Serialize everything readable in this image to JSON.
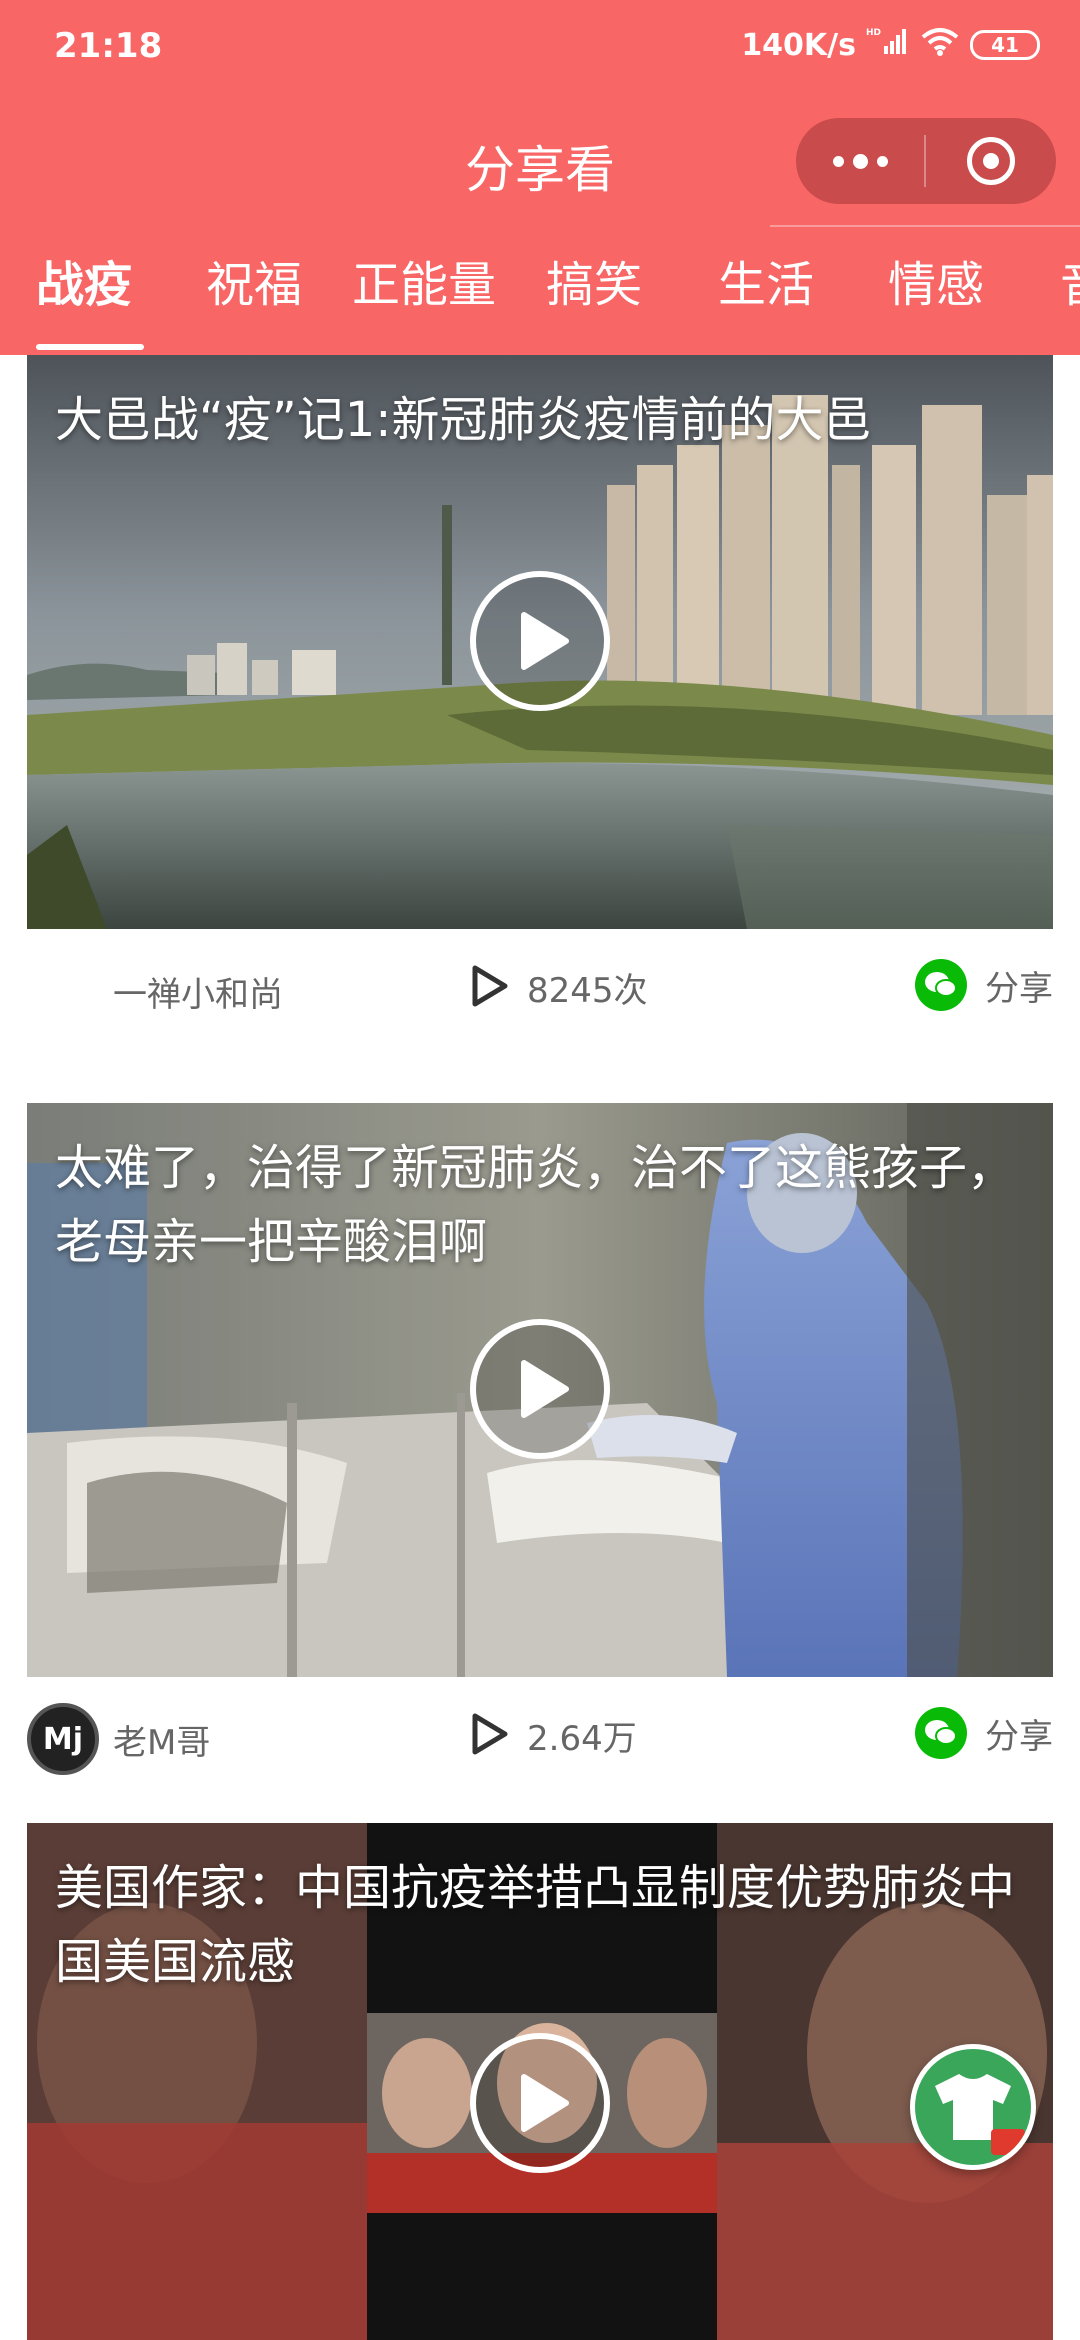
{
  "status_bar": {
    "time": "21:18",
    "network_speed": "140K/s",
    "network_type": "HD",
    "battery": "41"
  },
  "header": {
    "title": "分享看",
    "tabs": [
      {
        "label": "战疫",
        "active": true
      },
      {
        "label": "祝福",
        "active": false
      },
      {
        "label": "正能量",
        "active": false
      },
      {
        "label": "搞笑",
        "active": false
      },
      {
        "label": "生活",
        "active": false
      },
      {
        "label": "情感",
        "active": false
      },
      {
        "label": "音",
        "active": false
      }
    ]
  },
  "feed": [
    {
      "title": "大邑战“疫”记1:新冠肺炎疫情前的大邑",
      "author": "一禅小和尚",
      "has_avatar": false,
      "views": "8245次",
      "share_label": "分享",
      "thumbnail": "city-river-scene"
    },
    {
      "title": "太难了，治得了新冠肺炎，治不了这熊孩子，老母亲一把辛酸泪啊",
      "author": "老M哥",
      "has_avatar": true,
      "avatar_text": "Mj",
      "views": "2.64万",
      "share_label": "分享",
      "thumbnail": "hospital-ward-scene"
    },
    {
      "title": "美国作家：中国抗疫举措凸显制度优势肺炎中国美国流感",
      "thumbnail": "news-clip-scene"
    }
  ],
  "fab": {
    "icon": "tshirt-icon"
  },
  "colors": {
    "header_bg": "#f86666",
    "capsule_bg": "#c94b4b",
    "wechat_green": "#09bb07",
    "meta_text": "#666666"
  }
}
